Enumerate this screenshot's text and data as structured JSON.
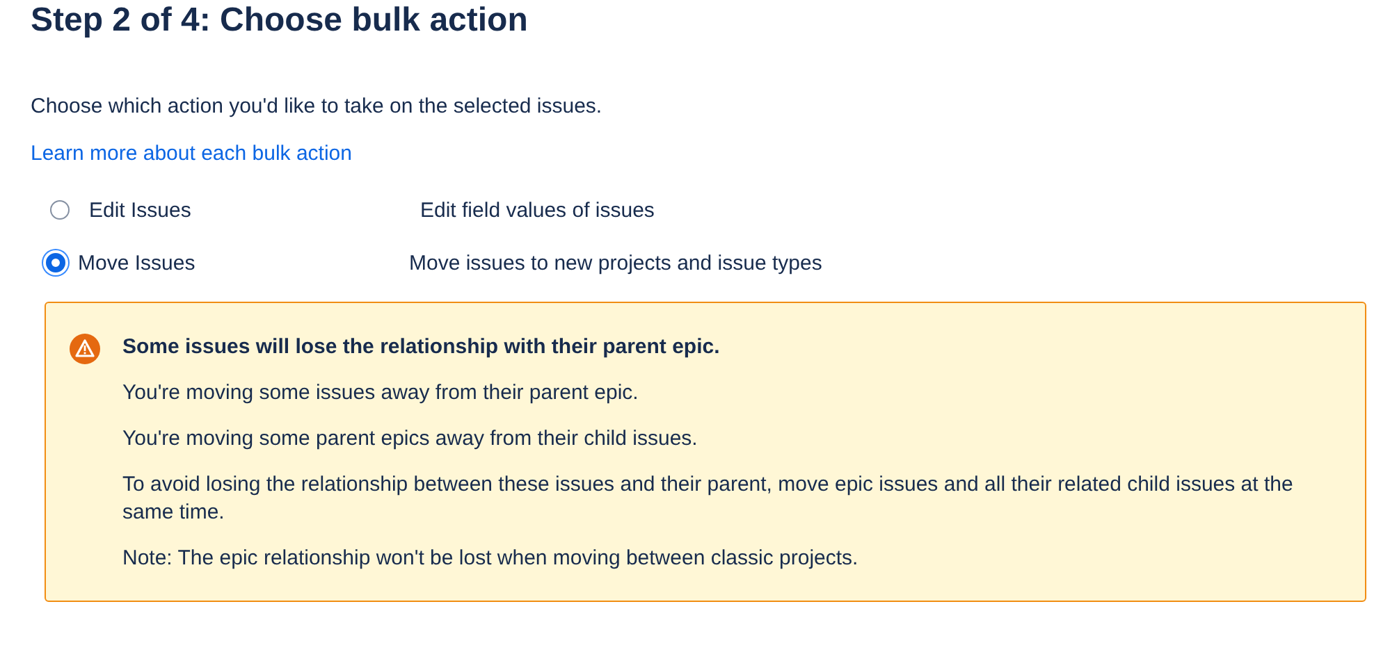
{
  "heading": "Step 2 of 4: Choose bulk action",
  "intro": "Choose which action you'd like to take on the selected issues.",
  "link": "Learn more about each bulk action",
  "options": [
    {
      "label": "Edit Issues",
      "description": "Edit field values of issues",
      "selected": false
    },
    {
      "label": "Move Issues",
      "description": "Move issues to new projects and issue types",
      "selected": true
    }
  ],
  "warning": {
    "title": "Some issues will lose the relationship with their parent epic.",
    "paragraphs": [
      "You're moving some issues away from their parent epic.",
      "You're moving some parent epics away from their child issues.",
      "To avoid losing the relationship between these issues and their parent, move epic issues and all their related child issues at the same time.",
      "Note: The epic relationship won't be lost when moving between classic projects."
    ]
  }
}
